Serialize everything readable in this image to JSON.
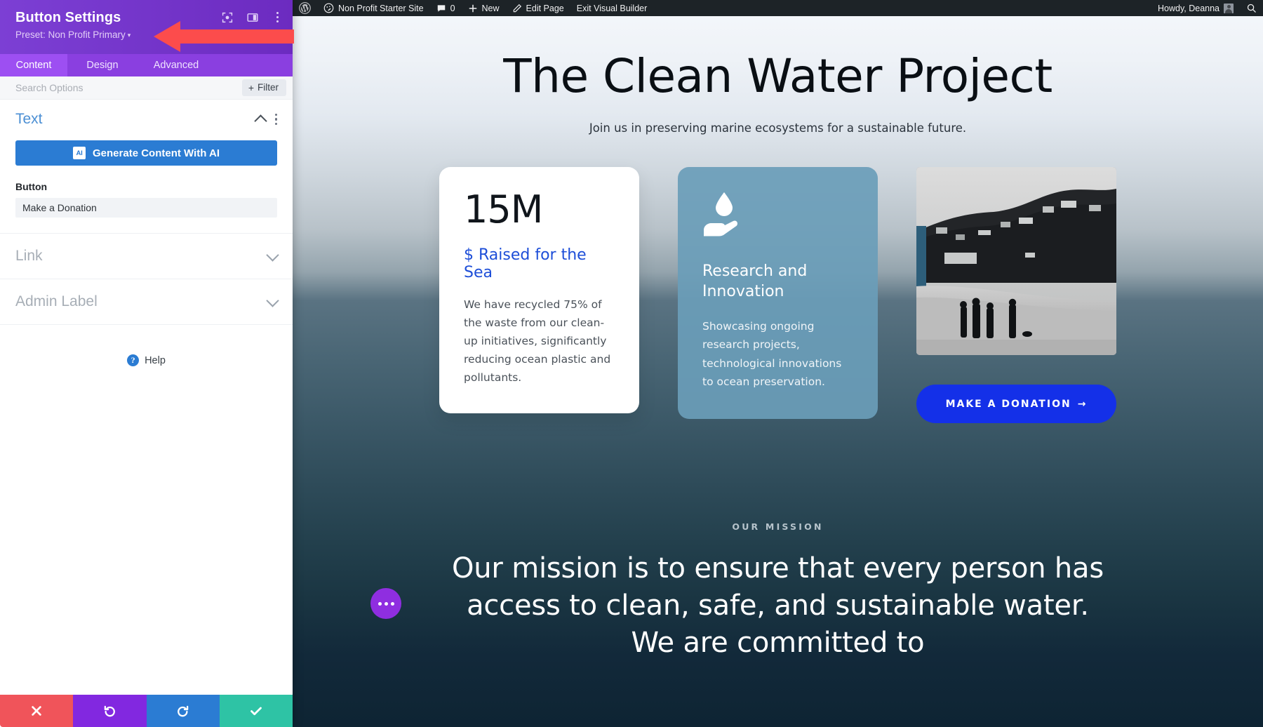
{
  "settings_panel": {
    "title": "Button Settings",
    "preset_label": "Preset: Non Profit Primary",
    "preset_caret": "▾",
    "header_icons": [
      {
        "name": "focus-target-icon"
      },
      {
        "name": "layout-columns-icon"
      },
      {
        "name": "kebab-menu-icon"
      }
    ],
    "tabs": [
      {
        "label": "Content",
        "active": true
      },
      {
        "label": "Design",
        "active": false
      },
      {
        "label": "Advanced",
        "active": false
      }
    ],
    "search": {
      "placeholder": "Search Options",
      "value": "",
      "filter_label": "Filter",
      "filter_plus": "+"
    },
    "sections": [
      {
        "title": "Text",
        "state": "expanded",
        "ai_button_label": "Generate Content With AI",
        "ai_badge": "AI",
        "field_label": "Button",
        "field_value": "Make a Donation"
      },
      {
        "title": "Link",
        "state": "collapsed"
      },
      {
        "title": "Admin Label",
        "state": "collapsed"
      }
    ],
    "help": {
      "label": "Help",
      "glyph": "?"
    },
    "footer_buttons": [
      {
        "name": "cancel-button",
        "glyph": "✕",
        "color": "#f0545a"
      },
      {
        "name": "undo-button",
        "glyph": "↺",
        "color": "#8228e0"
      },
      {
        "name": "redo-button",
        "glyph": "↻",
        "color": "#2b7cd3"
      },
      {
        "name": "save-button",
        "glyph": "✔",
        "color": "#2ec3a5"
      }
    ],
    "annotation": {
      "name": "red-arrow-annotation",
      "color": "#fc4c4c"
    }
  },
  "admin_bar": {
    "site_name": "Non Profit Starter Site",
    "comment_count": "0",
    "new_label": "New",
    "edit_page_label": "Edit Page",
    "exit_builder_label": "Exit Visual Builder",
    "howdy": "Howdy, Deanna"
  },
  "page": {
    "hero": {
      "title": "The Clean Water Project",
      "subtitle": "Join us in preserving marine ecosystems for a sustainable future."
    },
    "cards": [
      {
        "type": "stat",
        "number": "15M",
        "label": "$ Raised for the Sea",
        "body": "We have recycled 75% of the waste from our clean-up initiatives, significantly reducing ocean plastic and pollutants."
      },
      {
        "type": "feature",
        "icon": "water-drop-in-hand-icon",
        "title": "Research and Innovation",
        "body": "Showcasing ongoing research projects, technological innovations to ocean preservation."
      },
      {
        "type": "image-cta",
        "image_alt": "black-and-white coastal beach photo with people walking",
        "button_label": "MAKE A DONATION",
        "button_arrow": "→"
      }
    ],
    "mission": {
      "eyebrow": "OUR MISSION",
      "heading": "Our mission is to ensure that every person has access to clean, safe, and sustainable water. We are committed to"
    },
    "fab": {
      "name": "builder-fab",
      "color": "#8f2ee0"
    }
  },
  "colors": {
    "panel_purple": "#6c2eb9",
    "tab_active": "#9d4ff2",
    "accent_blue": "#2b7cd3",
    "link_blue": "#1d4ed8",
    "cta_blue": "#1430e8",
    "card_teal": "#6a9db9",
    "arrow_red": "#fc4c4c"
  }
}
